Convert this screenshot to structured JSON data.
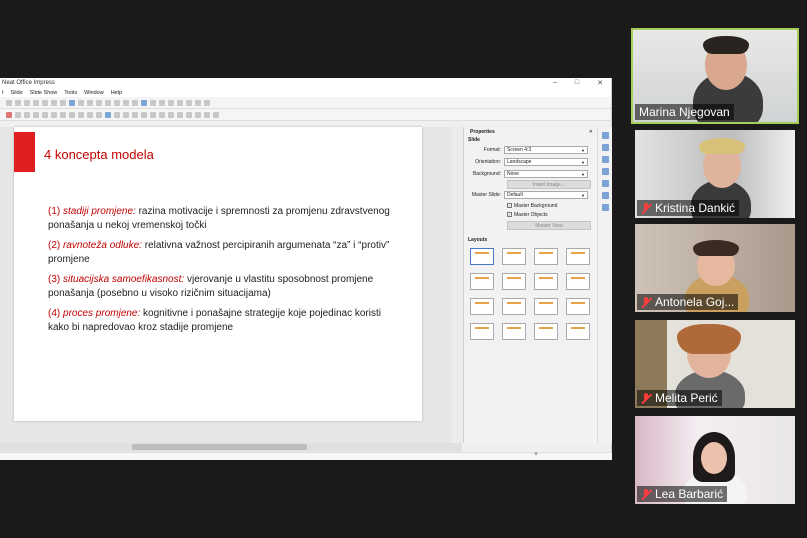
{
  "app": {
    "window_title": "Neat Office Impress",
    "menu": [
      "t",
      "Slide",
      "Slide Show",
      "Tools",
      "Window",
      "Help"
    ],
    "window_controls": [
      "–",
      "□",
      "✕"
    ]
  },
  "slide": {
    "title": "4 koncepta modela",
    "concepts": [
      {
        "num": "(1)",
        "term": "stadiji promjene:",
        "desc": " razina motivacije i spremnosti za promjenu zdravstvenog ponašanja u nekoj vremenskoj točki"
      },
      {
        "num": "(2)",
        "term": "ravnoteža odluke:",
        "desc": " relativna važnost percipiranih argumenata “za” i “protiv” promjene"
      },
      {
        "num": "(3)",
        "term": "situacijska samoefikasnost:",
        "desc": " vjerovanje u vlastitu sposobnost promjene ponašanja (posebno u visoko rizičnim situacijama)"
      },
      {
        "num": "(4)",
        "term": "proces promjene:",
        "desc": " kognitivne i ponašajne strategije koje pojedinac koristi kako bi napredovao kroz stadije promjene"
      }
    ]
  },
  "properties": {
    "header": "Properties",
    "close": "✕",
    "slide_section": "Slide",
    "format_label": "Format:",
    "format_value": "Screen 4:3",
    "orientation_label": "Orientation:",
    "orientation_value": "Landscape",
    "background_label": "Background:",
    "background_value": "None",
    "insert_image": "Insert Image...",
    "master_slide_label": "Master Slide:",
    "master_slide_value": "Default",
    "master_background": "Master Background",
    "master_objects": "Master Objects",
    "master_view": "Master View",
    "layouts_section": "Layouts"
  },
  "statusbar": {
    "plus": "+"
  },
  "participants": [
    {
      "name": "Marina Njegovan",
      "muted": false,
      "active": true
    },
    {
      "name": "Kristina Dankić",
      "muted": true,
      "active": false
    },
    {
      "name": "Antonela Goj...",
      "muted": true,
      "active": false
    },
    {
      "name": "Melita Perić",
      "muted": true,
      "active": false
    },
    {
      "name": "Lea Barbarić",
      "muted": true,
      "active": false
    }
  ],
  "colors": {
    "active_speaker_border": "#a7d05a",
    "slide_accent": "#c00000",
    "mute_icon": "#ff3b3b"
  }
}
